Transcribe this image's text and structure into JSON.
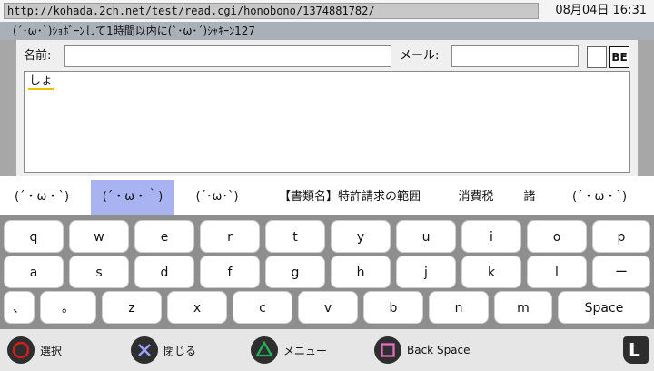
{
  "browser": {
    "url": "http://kohada.2ch.net/test/read.cgi/honobono/1374881782/",
    "datetime": "08月04日 16:31",
    "thread_title": "(´･ω･`)ｼｮﾎﾞｰﾝして1時間以内に(`･ω･´)ｼｬｷｰﾝ127"
  },
  "compose": {
    "name_label": "名前:",
    "name_value": "",
    "mail_label": "メール:",
    "mail_value": "",
    "be_label": "BE",
    "body_composing": "しょ"
  },
  "candidates": [
    "(´・ω・`)",
    "(´・ω・｀)",
    "(´･ω･`)",
    "【書類名】特許請求の範囲",
    "消費税",
    "諸",
    "(´・ω・`)"
  ],
  "selected_candidate": 1,
  "keyboard": {
    "row1": [
      "q",
      "w",
      "e",
      "r",
      "t",
      "y",
      "u",
      "i",
      "o",
      "p"
    ],
    "row2": [
      "a",
      "s",
      "d",
      "f",
      "g",
      "h",
      "j",
      "k",
      "l",
      "ー"
    ],
    "row3": [
      "、",
      "。",
      "z",
      "x",
      "c",
      "v",
      "b",
      "n",
      "m",
      "Space"
    ]
  },
  "hints": {
    "circle": "選択",
    "cross": "閉じる",
    "triangle": "メニュー",
    "square": "Back Space",
    "l_button": "L"
  },
  "colors": {
    "selected_candidate_bg": "#a9b3f2",
    "circle": "#d81c1c",
    "cross": "#9aa0ff",
    "triangle": "#22b35a",
    "square": "#e070c0"
  }
}
